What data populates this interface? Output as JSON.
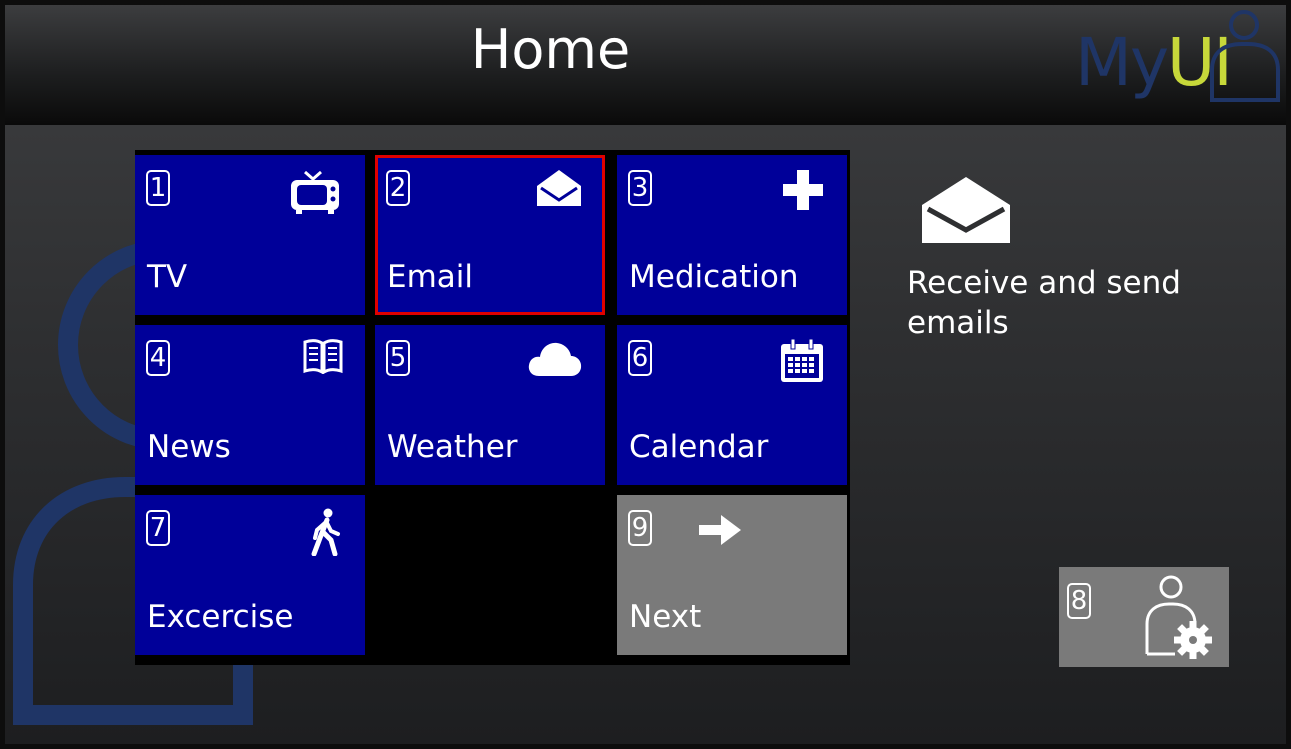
{
  "header": {
    "title": "Home",
    "logo": {
      "my": "My",
      "ui": "UI"
    }
  },
  "tiles": [
    {
      "number": "1",
      "label": "TV",
      "icon": "tv-icon"
    },
    {
      "number": "2",
      "label": "Email",
      "icon": "envelope-open-icon",
      "selected": true
    },
    {
      "number": "3",
      "label": "Medication",
      "icon": "plus-icon"
    },
    {
      "number": "4",
      "label": "News",
      "icon": "book-open-icon"
    },
    {
      "number": "5",
      "label": "Weather",
      "icon": "cloud-icon"
    },
    {
      "number": "6",
      "label": "Calendar",
      "icon": "calendar-icon"
    },
    {
      "number": "7",
      "label": "Excercise",
      "icon": "walking-person-icon"
    },
    {
      "number": "9",
      "label": "Next",
      "icon": "arrow-right-icon"
    }
  ],
  "info": {
    "icon": "envelope-open-icon",
    "text": "Receive and send emails"
  },
  "settings": {
    "number": "8",
    "icon": "user-settings-icon"
  },
  "colors": {
    "tile": "#000099",
    "tile_alt": "#7a7a7a",
    "selection": "#e00000",
    "logo_my": "#1f3566",
    "logo_ui": "#c7d83a",
    "background_person": "#1f3566"
  }
}
